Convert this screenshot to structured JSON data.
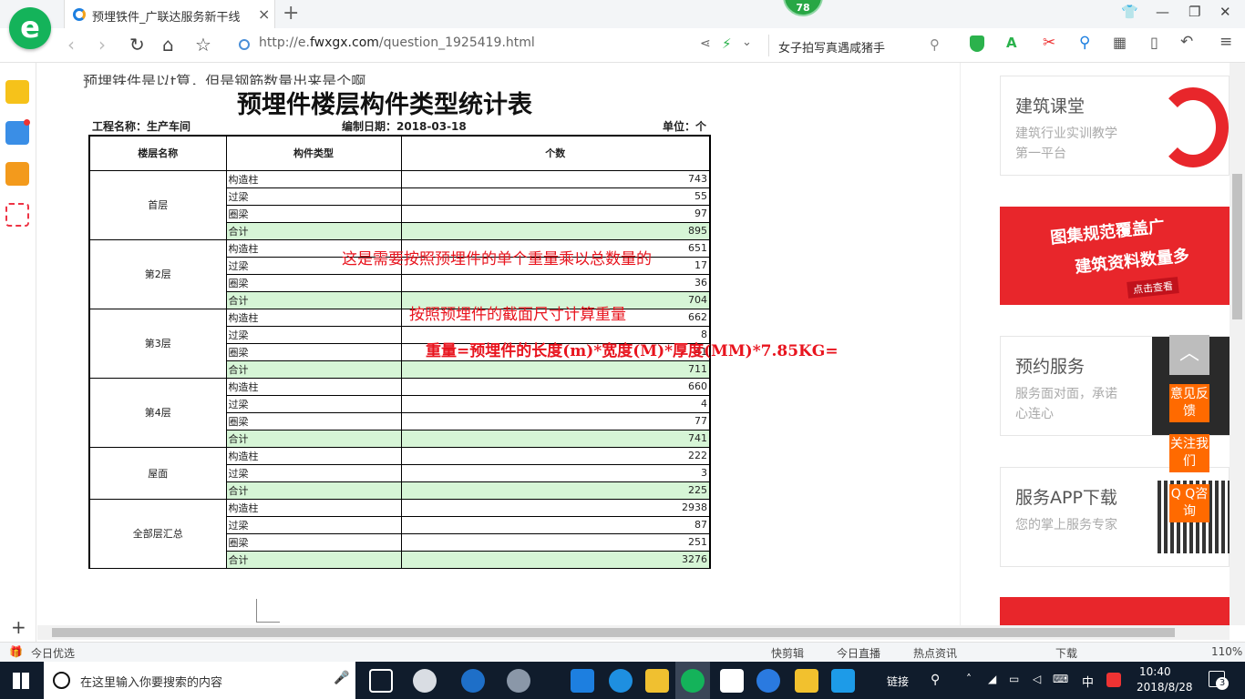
{
  "browser": {
    "tab_title": "预埋铁件_广联达服务新干线",
    "tab_close": "×",
    "new_tab": "+",
    "badge": "78",
    "url_prefix": "http://e.",
    "url_domain": "fwxgx.com",
    "url_path": "/question_1925419.html",
    "search_text": "女子拍写真遇咸猪手",
    "zoom": "110%"
  },
  "question_text": "预埋铁件是以t算，但是钢筋数量出来是个啊",
  "report": {
    "title": "预埋件楼层构件类型统计表",
    "project": "工程名称：生产车间",
    "date": "编制日期：2018-03-18",
    "unit": "单位：个",
    "headers": [
      "楼层名称",
      "构件类型",
      "个数"
    ],
    "groups": [
      {
        "floor": "首层",
        "rows": [
          {
            "type": "构造柱",
            "count": "743"
          },
          {
            "type": "过梁",
            "count": "55"
          },
          {
            "type": "圈梁",
            "count": "97"
          },
          {
            "type": "合计",
            "count": "895",
            "sum": true
          }
        ]
      },
      {
        "floor": "第2层",
        "rows": [
          {
            "type": "构造柱",
            "count": "651"
          },
          {
            "type": "过梁",
            "count": "17"
          },
          {
            "type": "圈梁",
            "count": "36"
          },
          {
            "type": "合计",
            "count": "704",
            "sum": true
          }
        ]
      },
      {
        "floor": "第3层",
        "rows": [
          {
            "type": "构造柱",
            "count": "662"
          },
          {
            "type": "过梁",
            "count": "8"
          },
          {
            "type": "圈梁",
            "count": "41"
          },
          {
            "type": "合计",
            "count": "711",
            "sum": true
          }
        ]
      },
      {
        "floor": "第4层",
        "rows": [
          {
            "type": "构造柱",
            "count": "660"
          },
          {
            "type": "过梁",
            "count": "4"
          },
          {
            "type": "圈梁",
            "count": "77"
          },
          {
            "type": "合计",
            "count": "741",
            "sum": true
          }
        ]
      },
      {
        "floor": "屋面",
        "rows": [
          {
            "type": "构造柱",
            "count": "222"
          },
          {
            "type": "过梁",
            "count": "3"
          },
          {
            "type": "合计",
            "count": "225",
            "sum": true
          }
        ]
      },
      {
        "floor": "全部层汇总",
        "rows": [
          {
            "type": "构造柱",
            "count": "2938"
          },
          {
            "type": "过梁",
            "count": "87"
          },
          {
            "type": "圈梁",
            "count": "251"
          },
          {
            "type": "合计",
            "count": "3276",
            "sum": true
          }
        ]
      }
    ]
  },
  "annotations": {
    "line1": "这是需要按照预埋件的单个重量乘以总数量的",
    "line2": "按照预埋件的截面尺寸计算重量",
    "line3": "重量=预埋件的长度(m)*宽度(M)*厚度(MM)*7.85KG="
  },
  "sidebar_cards": {
    "course": {
      "title": "建筑课堂",
      "sub": "建筑行业实训教学第一平台"
    },
    "banner": {
      "line1": "图集规范覆盖广",
      "line2": "建筑资料数量多",
      "btn": "点击查看"
    },
    "service": {
      "title": "预约服务",
      "sub": "服务面对面，承诺心连心"
    },
    "app": {
      "title": "服务APP下载",
      "sub": "您的掌上服务专家"
    }
  },
  "float_buttons": {
    "feedback": "意见反馈",
    "follow": "关注我们",
    "qq": "Q Q咨询"
  },
  "status_bar": {
    "left": "今日优选",
    "items": [
      "快剪辑",
      "今日直播",
      "热点资讯",
      "下载"
    ]
  },
  "taskbar": {
    "search_placeholder": "在这里输入你要搜索的内容",
    "link": "链接",
    "ime": "中",
    "time": "10:40",
    "date": "2018/8/28",
    "notif": "3"
  },
  "colors": {
    "accent": "#14b35a",
    "annotation": "#e8141e",
    "sum_row": "#d6f5d6",
    "float": "#ff6a00",
    "taskbar": "#101c2c"
  }
}
